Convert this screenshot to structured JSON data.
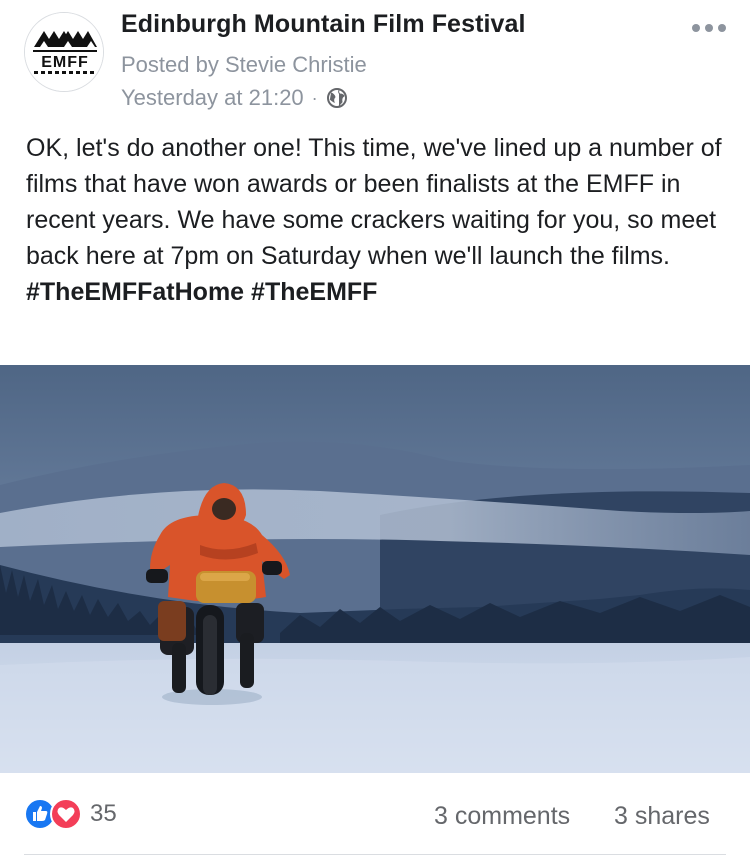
{
  "post": {
    "page_name": "Edinburgh Mountain Film Festival",
    "posted_by": "Posted by Stevie Christie",
    "timestamp": "Yesterday at 21:20",
    "separator": "·",
    "privacy_icon": "globe-icon",
    "more_icon": "more-horizontal-icon",
    "avatar_logo_text": "EMFF",
    "text": "OK, let's do another one! This time, we've lined up a number of films that have won awards or been finalists at the EMFF in recent years. We have some crackers waiting for you, so meet back here at 7pm on Saturday when we'll launch the films.",
    "hashtags": [
      "#TheEMFFatHome",
      "#TheEMFF"
    ]
  },
  "stats": {
    "reaction_icons": [
      "like-icon",
      "love-icon"
    ],
    "reaction_count": "35",
    "comments": "3 comments",
    "shares": "3 shares"
  },
  "colors": {
    "like": "#1877f2",
    "love": "#f33e58",
    "meta_text": "#8d949e"
  }
}
